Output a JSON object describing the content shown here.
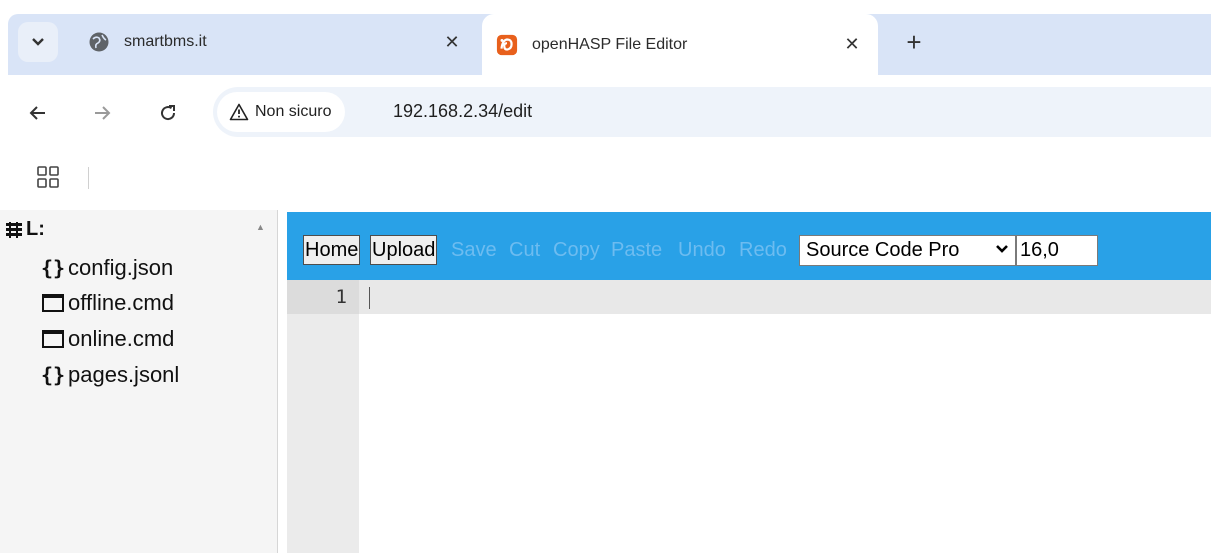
{
  "browser": {
    "tabs": [
      {
        "title": "smartbms.it",
        "active": false,
        "favicon": "globe-icon"
      },
      {
        "title": "openHASP File Editor",
        "active": true,
        "favicon": "openhasp-icon"
      }
    ],
    "tab_search_icon": "chevron-down-icon",
    "new_tab_icon": "plus-icon",
    "close_icon": "close-icon"
  },
  "address_bar": {
    "security_label": "Non sicuro",
    "url": "192.168.2.34/edit"
  },
  "file_tree": {
    "root_label": "L:",
    "items": [
      {
        "name": "config.json",
        "type": "json",
        "icon_text": "{}"
      },
      {
        "name": "offline.cmd",
        "type": "file",
        "icon_text": ""
      },
      {
        "name": "online.cmd",
        "type": "file",
        "icon_text": ""
      },
      {
        "name": "pages.jsonl",
        "type": "json",
        "icon_text": "{}"
      }
    ]
  },
  "editor_toolbar": {
    "buttons": [
      {
        "label": "Home",
        "enabled": true
      },
      {
        "label": "Upload",
        "enabled": true
      },
      {
        "label": "Save",
        "enabled": false
      },
      {
        "label": "Cut",
        "enabled": false
      },
      {
        "label": "Copy",
        "enabled": false
      },
      {
        "label": "Paste",
        "enabled": false
      },
      {
        "label": "Undo",
        "enabled": false
      },
      {
        "label": "Redo",
        "enabled": false
      }
    ],
    "font_select_value": "Source Code Pro",
    "font_size_value": "16,0"
  },
  "editor": {
    "line_numbers": [
      "1"
    ]
  },
  "colors": {
    "toolbar_blue": "#29a1e7",
    "disabled_text": "#6dbcf0",
    "tabstrip_bg": "#d9e4f7"
  }
}
